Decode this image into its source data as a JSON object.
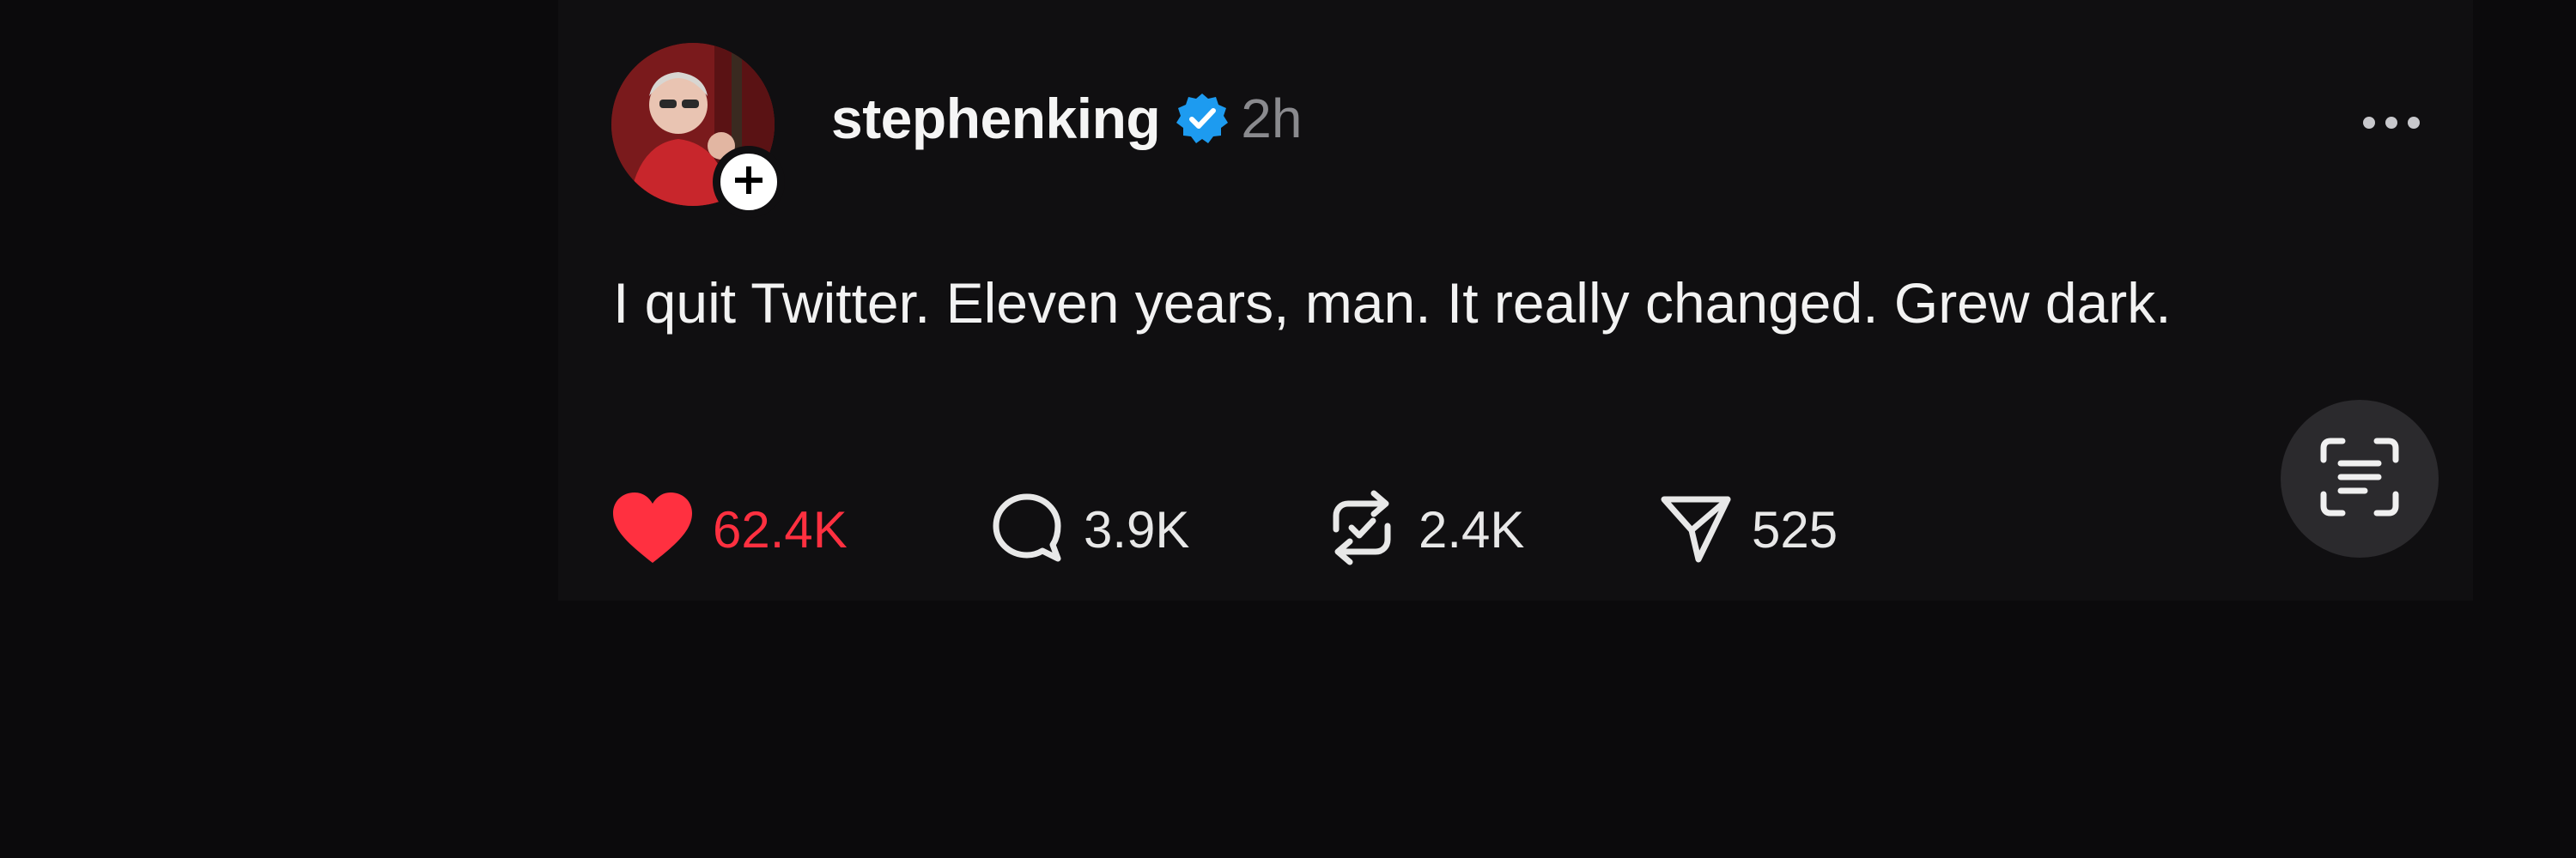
{
  "post": {
    "username": "stephenking",
    "time": "2h",
    "text": "I quit Twitter. Eleven years, man. It really changed. Grew dark.",
    "avatar_icon": "profile-photo",
    "follow_icon": "plus-icon",
    "verified_icon": "verified-badge-icon",
    "more_icon": "more-horizontal-icon"
  },
  "actions": {
    "like": {
      "icon": "heart-icon",
      "count": "62.4K",
      "active": true
    },
    "comment": {
      "icon": "comment-icon",
      "count": "3.9K"
    },
    "repost": {
      "icon": "repost-icon",
      "count": "2.4K"
    },
    "share": {
      "icon": "send-icon",
      "count": "525"
    }
  },
  "overlay": {
    "scan_icon": "text-scan-icon"
  },
  "colors": {
    "background": "#0b0a0c",
    "card": "#100f11",
    "like_active": "#ff3040",
    "verified": "#1d9bf0",
    "muted_text": "#8a8a8e"
  }
}
